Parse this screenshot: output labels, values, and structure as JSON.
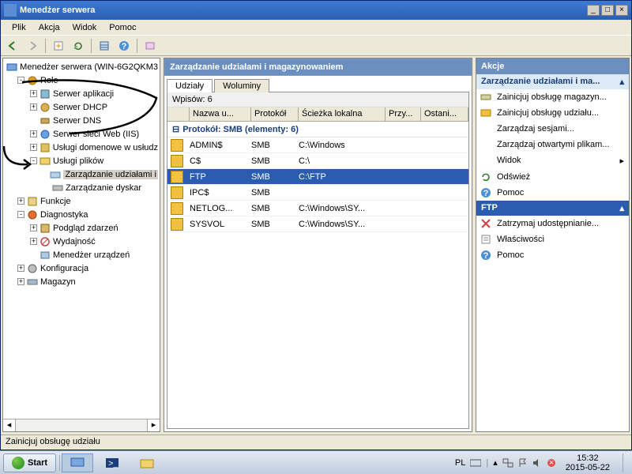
{
  "window": {
    "title": "Menedżer serwera"
  },
  "menu": {
    "plik": "Plik",
    "akcja": "Akcja",
    "widok": "Widok",
    "pomoc": "Pomoc"
  },
  "tree": {
    "root": "Menedżer serwera (WIN-6G2QKM3",
    "role": "Role",
    "role_items": {
      "app": "Serwer aplikacji",
      "dhcp": "Serwer DHCP",
      "dns": "Serwer DNS",
      "iis": "Serwer sieci Web (IIS)",
      "ad": "Usługi domenowe w usłudz",
      "files": "Usługi plików",
      "shares": "Zarządzanie udziałami i",
      "disks": "Zarządzanie dyskar"
    },
    "funkcje": "Funkcje",
    "diag": "Diagnostyka",
    "diag_items": {
      "events": "Podgląd zdarzeń",
      "perf": "Wydajność",
      "devmgr": "Menedżer urządzeń"
    },
    "konfig": "Konfiguracja",
    "magazyn": "Magazyn"
  },
  "mid": {
    "header": "Zarządzanie udziałami i magazynowaniem",
    "tabs": {
      "shares": "Udziały",
      "volumes": "Woluminy"
    },
    "count_label": "Wpisów: 6",
    "columns": {
      "name": "Nazwa u...",
      "proto": "Protokół",
      "path": "Ścieżka lokalna",
      "assign": "Przy...",
      "last": "Ostani..."
    },
    "group": "Protokół: SMB (elementy: 6)",
    "rows": [
      {
        "name": "ADMIN$",
        "proto": "SMB",
        "path": "C:\\Windows"
      },
      {
        "name": "C$",
        "proto": "SMB",
        "path": "C:\\"
      },
      {
        "name": "FTP",
        "proto": "SMB",
        "path": "C:\\FTP"
      },
      {
        "name": "IPC$",
        "proto": "SMB",
        "path": ""
      },
      {
        "name": "NETLOG...",
        "proto": "SMB",
        "path": "C:\\Windows\\SY..."
      },
      {
        "name": "SYSVOL",
        "proto": "SMB",
        "path": "C:\\Windows\\SY..."
      }
    ]
  },
  "actions": {
    "header": "Akcje",
    "group1": "Zarządzanie udziałami i ma...",
    "items1": {
      "storage": "Zainicjuj obsługę magazyn...",
      "share": "Zainicjuj obsługę udziału...",
      "sessions": "Zarządzaj sesjami...",
      "files": "Zarządzaj otwartymi plikam...",
      "view": "Widok",
      "refresh": "Odśwież",
      "help": "Pomoc"
    },
    "group2": "FTP",
    "items2": {
      "stop": "Zatrzymaj udostępnianie...",
      "props": "Właściwości",
      "help": "Pomoc"
    }
  },
  "statusbar": "Zainicjuj obsługę udziału",
  "taskbar": {
    "start": "Start",
    "lang": "PL",
    "time": "15:32",
    "date": "2015-05-22"
  }
}
